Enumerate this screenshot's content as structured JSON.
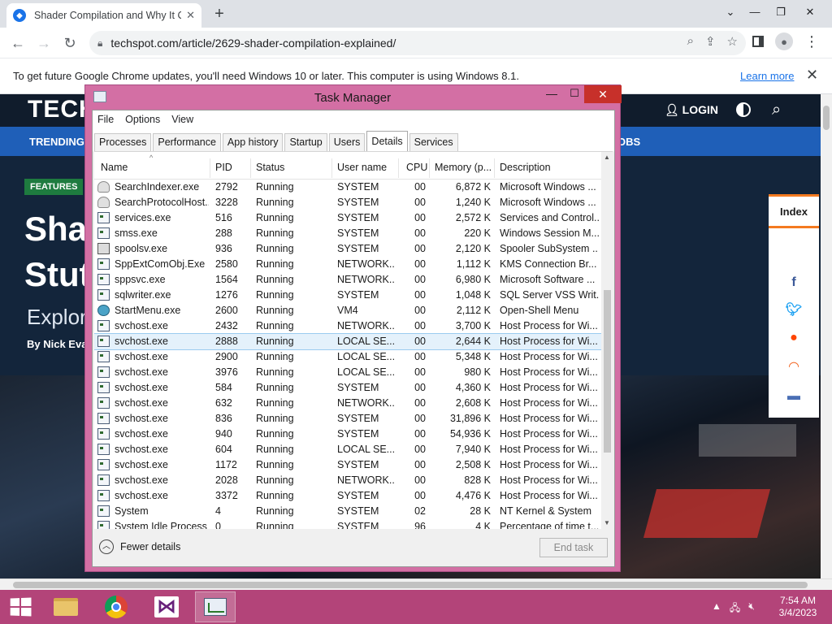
{
  "browser": {
    "tab_title": "Shader Compilation and Why It C",
    "url": "techspot.com/article/2629-shader-compilation-explained/",
    "infobar_message": "To get future Google Chrome updates, you'll need Windows 10 or later. This computer is using Windows 8.1.",
    "learn_more": "Learn more"
  },
  "site": {
    "logo": "TECH",
    "login": "LOGIN",
    "trending": "TRENDING",
    "jobs": "OBS",
    "features_badge": "FEATURES",
    "headline_1": "Shad",
    "headline_2": "Stut",
    "subhead": "Explor",
    "byline_prefix": "By ",
    "byline_author": "Nick Evan",
    "index": "Index"
  },
  "taskmanager": {
    "title": "Task Manager",
    "menu": [
      "File",
      "Options",
      "View"
    ],
    "tabs": [
      "Processes",
      "Performance",
      "App history",
      "Startup",
      "Users",
      "Details",
      "Services"
    ],
    "active_tab": "Details",
    "columns": [
      "Name",
      "PID",
      "Status",
      "User name",
      "CPU",
      "Memory (p...",
      "Description"
    ],
    "rows": [
      {
        "icon": "user",
        "name": "SearchIndexer.exe",
        "pid": "2792",
        "status": "Running",
        "user": "SYSTEM",
        "cpu": "00",
        "mem": "6,872 K",
        "desc": "Microsoft Windows ..."
      },
      {
        "icon": "user",
        "name": "SearchProtocolHost....",
        "pid": "3228",
        "status": "Running",
        "user": "SYSTEM",
        "cpu": "00",
        "mem": "1,240 K",
        "desc": "Microsoft Windows ..."
      },
      {
        "icon": "app",
        "name": "services.exe",
        "pid": "516",
        "status": "Running",
        "user": "SYSTEM",
        "cpu": "00",
        "mem": "2,572 K",
        "desc": "Services and Control..."
      },
      {
        "icon": "app",
        "name": "smss.exe",
        "pid": "288",
        "status": "Running",
        "user": "SYSTEM",
        "cpu": "00",
        "mem": "220 K",
        "desc": "Windows Session M..."
      },
      {
        "icon": "printer",
        "name": "spoolsv.exe",
        "pid": "936",
        "status": "Running",
        "user": "SYSTEM",
        "cpu": "00",
        "mem": "2,120 K",
        "desc": "Spooler SubSystem ..."
      },
      {
        "icon": "app",
        "name": "SppExtComObj.Exe",
        "pid": "2580",
        "status": "Running",
        "user": "NETWORK...",
        "cpu": "00",
        "mem": "1,112 K",
        "desc": "KMS Connection Br..."
      },
      {
        "icon": "app",
        "name": "sppsvc.exe",
        "pid": "1564",
        "status": "Running",
        "user": "NETWORK...",
        "cpu": "00",
        "mem": "6,980 K",
        "desc": "Microsoft Software ..."
      },
      {
        "icon": "app",
        "name": "sqlwriter.exe",
        "pid": "1276",
        "status": "Running",
        "user": "SYSTEM",
        "cpu": "00",
        "mem": "1,048 K",
        "desc": "SQL Server VSS Writ..."
      },
      {
        "icon": "globe",
        "name": "StartMenu.exe",
        "pid": "2600",
        "status": "Running",
        "user": "VM4",
        "cpu": "00",
        "mem": "2,112 K",
        "desc": "Open-Shell Menu"
      },
      {
        "icon": "app",
        "name": "svchost.exe",
        "pid": "2432",
        "status": "Running",
        "user": "NETWORK...",
        "cpu": "00",
        "mem": "3,700 K",
        "desc": "Host Process for Wi..."
      },
      {
        "icon": "app",
        "name": "svchost.exe",
        "pid": "2888",
        "status": "Running",
        "user": "LOCAL SE...",
        "cpu": "00",
        "mem": "2,644 K",
        "desc": "Host Process for Wi...",
        "selected": true
      },
      {
        "icon": "app",
        "name": "svchost.exe",
        "pid": "2900",
        "status": "Running",
        "user": "LOCAL SE...",
        "cpu": "00",
        "mem": "5,348 K",
        "desc": "Host Process for Wi..."
      },
      {
        "icon": "app",
        "name": "svchost.exe",
        "pid": "3976",
        "status": "Running",
        "user": "LOCAL SE...",
        "cpu": "00",
        "mem": "980 K",
        "desc": "Host Process for Wi..."
      },
      {
        "icon": "app",
        "name": "svchost.exe",
        "pid": "584",
        "status": "Running",
        "user": "SYSTEM",
        "cpu": "00",
        "mem": "4,360 K",
        "desc": "Host Process for Wi..."
      },
      {
        "icon": "app",
        "name": "svchost.exe",
        "pid": "632",
        "status": "Running",
        "user": "NETWORK...",
        "cpu": "00",
        "mem": "2,608 K",
        "desc": "Host Process for Wi..."
      },
      {
        "icon": "app",
        "name": "svchost.exe",
        "pid": "836",
        "status": "Running",
        "user": "SYSTEM",
        "cpu": "00",
        "mem": "31,896 K",
        "desc": "Host Process for Wi..."
      },
      {
        "icon": "app",
        "name": "svchost.exe",
        "pid": "940",
        "status": "Running",
        "user": "SYSTEM",
        "cpu": "00",
        "mem": "54,936 K",
        "desc": "Host Process for Wi..."
      },
      {
        "icon": "app",
        "name": "svchost.exe",
        "pid": "604",
        "status": "Running",
        "user": "LOCAL SE...",
        "cpu": "00",
        "mem": "7,940 K",
        "desc": "Host Process for Wi..."
      },
      {
        "icon": "app",
        "name": "svchost.exe",
        "pid": "1172",
        "status": "Running",
        "user": "SYSTEM",
        "cpu": "00",
        "mem": "2,508 K",
        "desc": "Host Process for Wi..."
      },
      {
        "icon": "app",
        "name": "svchost.exe",
        "pid": "2028",
        "status": "Running",
        "user": "NETWORK...",
        "cpu": "00",
        "mem": "828 K",
        "desc": "Host Process for Wi..."
      },
      {
        "icon": "app",
        "name": "svchost.exe",
        "pid": "3372",
        "status": "Running",
        "user": "SYSTEM",
        "cpu": "00",
        "mem": "4,476 K",
        "desc": "Host Process for Wi..."
      },
      {
        "icon": "app",
        "name": "System",
        "pid": "4",
        "status": "Running",
        "user": "SYSTEM",
        "cpu": "02",
        "mem": "28 K",
        "desc": "NT Kernel & System"
      },
      {
        "icon": "app",
        "name": "System Idle Process",
        "pid": "0",
        "status": "Running",
        "user": "SYSTEM",
        "cpu": "96",
        "mem": "4 K",
        "desc": "Percentage of time t..."
      }
    ],
    "fewer_details": "Fewer details",
    "end_task": "End task"
  },
  "taskbar": {
    "time": "7:54 AM",
    "date": "3/4/2023"
  },
  "colors": {
    "taskbar": "#b34479",
    "window_frame": "#d36fa4",
    "close_button": "#c7302a",
    "trending_bar": "#1f5fb8"
  }
}
